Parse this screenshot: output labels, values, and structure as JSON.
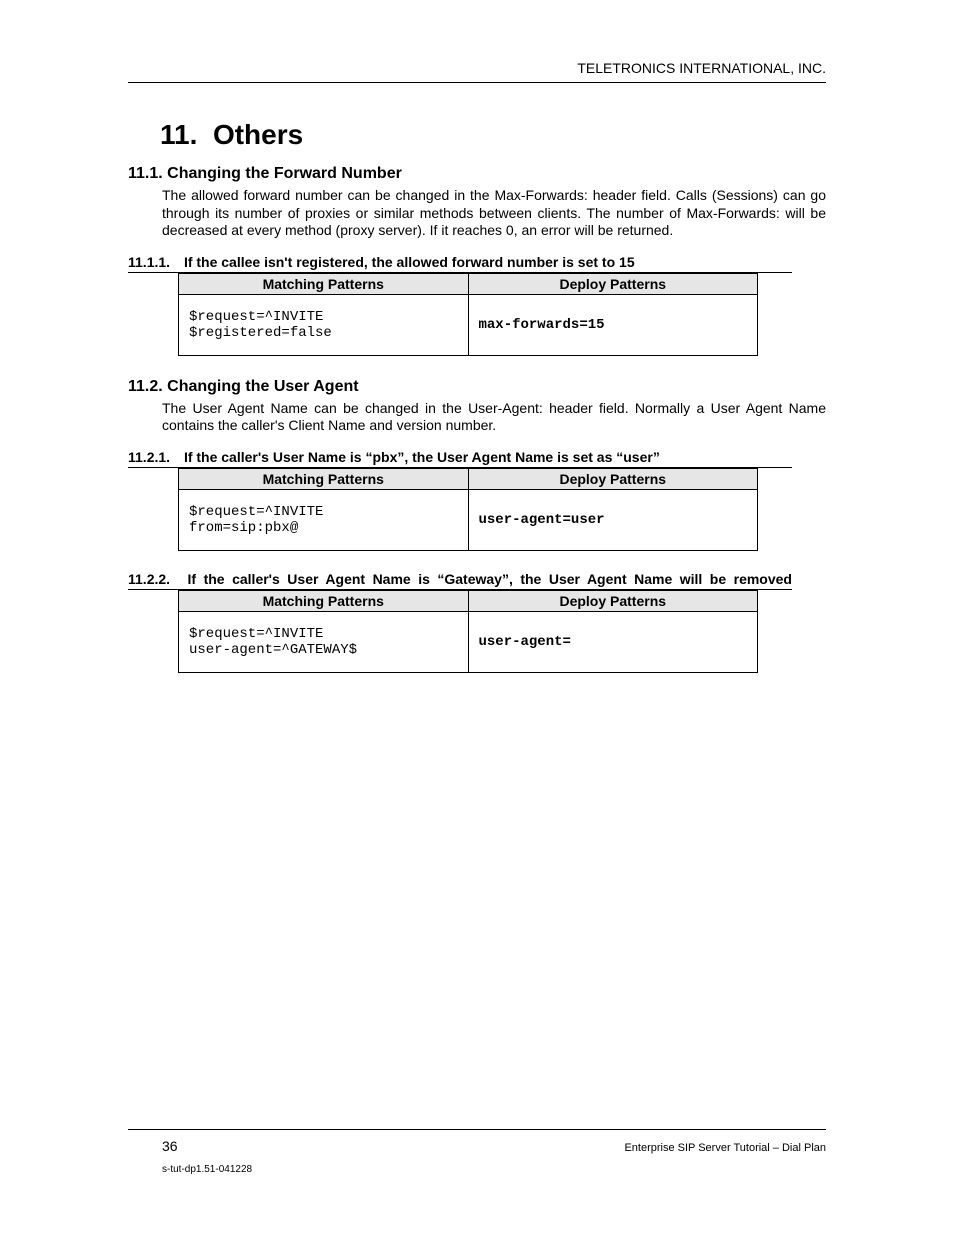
{
  "header": {
    "company": "TELETRONICS INTERNATIONAL, INC."
  },
  "chapter": {
    "number": "11.",
    "title": "Others"
  },
  "sections": [
    {
      "number": "11.1.",
      "title": "Changing the Forward Number",
      "body": "The allowed forward number can be changed in the Max-Forwards: header field. Calls (Sessions) can go through its number of proxies or similar methods between clients. The number of Max-Forwards: will be decreased at every method (proxy server). If it reaches 0, an error will be returned.",
      "subsections": [
        {
          "number": "11.1.1.",
          "title": "If the callee isn't registered, the allowed forward number is set to 15",
          "table": {
            "col1": "Matching Patterns",
            "col2": "Deploy Patterns",
            "matching": "$request=^INVITE\n$registered=false",
            "deploy": "max-forwards=15"
          }
        }
      ]
    },
    {
      "number": "11.2.",
      "title": "Changing the User Agent",
      "body": "The User Agent Name can be changed in the User-Agent: header field. Normally a User Agent Name contains the caller's Client Name and version number.",
      "subsections": [
        {
          "number": "11.2.1.",
          "title": "If the caller's User Name is “pbx”, the User Agent Name is set as “user”",
          "table": {
            "col1": "Matching Patterns",
            "col2": "Deploy Patterns",
            "matching": "$request=^INVITE\nfrom=sip:pbx@",
            "deploy": "user-agent=user"
          }
        },
        {
          "number": "11.2.2.",
          "title": "If the caller's User Agent Name is “Gateway”, the User Agent Name will be removed",
          "table": {
            "col1": "Matching Patterns",
            "col2": "Deploy Patterns",
            "matching": "$request=^INVITE\nuser-agent=^GATEWAY$",
            "deploy": "user-agent="
          }
        }
      ]
    }
  ],
  "footer": {
    "page": "36",
    "right": "Enterprise SIP Server Tutorial – Dial Plan",
    "docid": "s-tut-dp1.51-041228"
  }
}
